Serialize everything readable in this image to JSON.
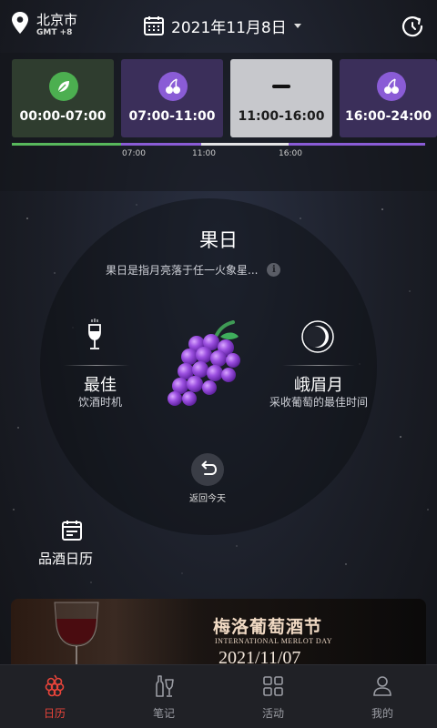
{
  "header": {
    "city": "北京市",
    "timezone": "GMT +8",
    "date": "2021年11月8日"
  },
  "slots": [
    {
      "range": "00:00-07:00",
      "icon": "leaf-icon",
      "state": "past"
    },
    {
      "range": "07:00-11:00",
      "icon": "cherry-icon",
      "state": "future"
    },
    {
      "range": "11:00-16:00",
      "icon": "dash-icon",
      "state": "selected"
    },
    {
      "range": "16:00-24:00",
      "icon": "cherry-icon",
      "state": "future"
    }
  ],
  "timeline": {
    "ticks": [
      "07:00",
      "11:00",
      "16:00"
    ]
  },
  "day": {
    "type": "果日",
    "description": "果日是指月亮落于任一火象星...",
    "left_title": "最佳",
    "left_sub": "饮酒时机",
    "right_title": "峨眉月",
    "right_sub": "采收葡萄的最佳时间",
    "return_label": "返回今天"
  },
  "wine_calendar": {
    "label": "品酒日历"
  },
  "banner": {
    "title": "梅洛葡萄酒节",
    "subtitle": "INTERNATIONAL MERLOT DAY",
    "date": "2021/11/07"
  },
  "tabs": [
    {
      "label": "日历",
      "icon": "grape-calendar-icon",
      "active": true
    },
    {
      "label": "笔记",
      "icon": "wine-bottle-icon",
      "active": false
    },
    {
      "label": "活动",
      "icon": "grid-icon",
      "active": false
    },
    {
      "label": "我的",
      "icon": "user-icon",
      "active": false
    }
  ],
  "colors": {
    "accent_red": "#e8443a",
    "slot_green": "#4caf50",
    "slot_purple": "#8a5cd6",
    "grape": "#8e3fd8"
  }
}
